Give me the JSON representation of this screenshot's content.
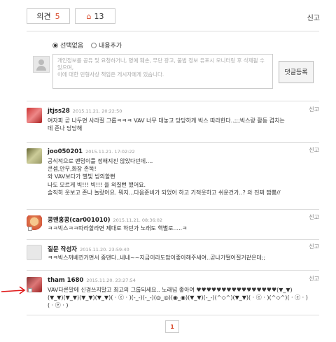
{
  "top": {
    "opinion_label": "의견",
    "opinion_count": "5",
    "like_icon": "house-icon",
    "like_count": "13",
    "report_label": "신고"
  },
  "compose": {
    "option_none": "선택없음",
    "option_add": "내용추가",
    "placeholder_line1": "개인정보를 공유 및 요청하거나, 명예 훼손, 무단 광고, 불법 정보 유포시 모니터링 후 삭제될 수 있으며,",
    "placeholder_line2": "이에 대한 민형사상 책임은 게시자에게 있습니다.",
    "submit_label": "댓글등록"
  },
  "comments": [
    {
      "name": "jtjss28",
      "date": "2015.11.21. 20:22:50",
      "lines": [
        "여자피 곧 나두면 사라질 그룹ㅋㅋㅋ VAV 너무 대놓고 당당하게 빅스 따라한다..;;;빅스랑 활동 겹치는",
        "데 존나 당당해"
      ],
      "report": "신고"
    },
    {
      "name": "joo050201",
      "date": "2015.11.21. 17:02:22",
      "lines": [
        "공식적으로 팬덤이를 정해지진 않았다던데....",
        "콘셉,안무,화장 존똑!",
        "와 VAV보다가 별빛 빙의할뻔",
        "나도 모르게 빅!!! 빅!!! 을 외칠뻔 했어요.",
        "솔직히 웃보고 존나 놀랐어요. 뭐지...다음준비가 되었어 하고 기적웃하고 쉬운건가..? 와 진짜 짬뽕//"
      ],
      "report": "신고"
    },
    {
      "name": "콩맨홍콩(car001010)",
      "date": "2015.11.21. 08:36:02",
      "lines": [
        "ㅋㅋ빅스ㅋㅋ따라할라면 제대로 하던가 노래도 핵별로.....ㅋ"
      ],
      "report": "신고"
    },
    {
      "name": "질문 작성자",
      "date": "2015.11.20. 23:59:40",
      "lines": [
        "ㅋㅋ빅스꺼베낀거면서 중댄다..네네~~지금이라도맘이좋아해주세여..곧나가떨어질거같은데;;"
      ],
      "report": "신고"
    },
    {
      "name": "tham 1680",
      "date": "2015.11.20. 23:27:54",
      "lines": [
        "VAV다른말에 신경쓰지말고 최고의 그룹되세요.. 노래넘 좋아여 ♥♥♥♥♥♥♥♥♥♥♥♥♥♥♥♥(▼_▼)",
        "(▼_▼)(▼_▼)(▼_▼)(▼_▼)( · ⓔ · )(-_-)(-_-)(◎_◎)(◉_◉)(▼_▼)(-_-)(^◇^)(▼_▼)( · ⓔ · )(^◇^)( · ⓔ · )",
        "( · ⓔ · )"
      ],
      "report": "신고"
    }
  ],
  "pager": {
    "current": "1"
  }
}
